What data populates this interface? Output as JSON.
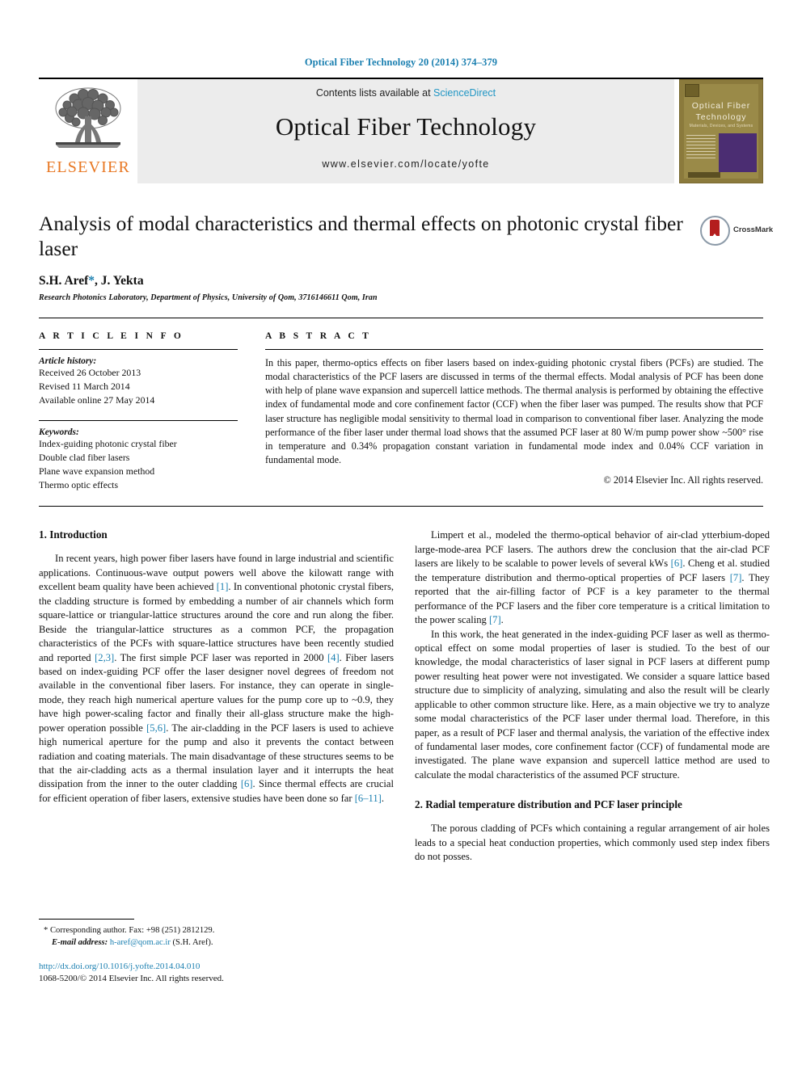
{
  "running_head": "Optical Fiber Technology 20 (2014) 374–379",
  "masthead": {
    "publisher_name": "ELSEVIER",
    "contents_prefix": "Contents lists available at ",
    "sciencedirect": "ScienceDirect",
    "journal_title": "Optical Fiber Technology",
    "journal_url": "www.elsevier.com/locate/yofte",
    "cover": {
      "line1": "Optical  Fiber",
      "line2": "Technology",
      "line3": "Materials, Devices, and Systems"
    }
  },
  "article": {
    "title": "Analysis of modal characteristics and thermal effects on photonic crystal fiber laser",
    "authors": "S.H. Aref",
    "author_star": "*",
    "authors_rest": ", J. Yekta",
    "affiliation": "Research Photonics Laboratory, Department of Physics, University of Qom, 3716146611 Qom, Iran",
    "crossmark_label": "CrossMark"
  },
  "info": {
    "heading": "A R T I C L E   I N F O",
    "history_label": "Article history:",
    "history": [
      "Received 26 October 2013",
      "Revised 11 March 2014",
      "Available online 27 May 2014"
    ],
    "keywords_label": "Keywords:",
    "keywords": [
      "Index-guiding photonic crystal fiber",
      "Double clad fiber lasers",
      "Plane wave expansion method",
      "Thermo optic effects"
    ]
  },
  "abstract": {
    "heading": "A B S T R A C T",
    "text": "In this paper, thermo-optics effects on fiber lasers based on index-guiding photonic crystal fibers (PCFs) are studied. The modal characteristics of the PCF lasers are discussed in terms of the thermal effects. Modal analysis of PCF has been done with help of plane wave expansion and supercell lattice methods. The thermal analysis is performed by obtaining the effective index of fundamental mode and core confinement factor (CCF) when the fiber laser was pumped. The results show that PCF laser structure has negligible modal sensitivity to thermal load in comparison to conventional fiber laser. Analyzing the mode performance of the fiber laser under thermal load shows that the assumed PCF laser at 80 W/m pump power show ~500° rise in temperature and 0.34% propagation constant variation in fundamental mode index and 0.04% CCF variation in fundamental mode.",
    "copyright": "© 2014 Elsevier Inc. All rights reserved."
  },
  "body": {
    "section1_heading": "1. Introduction",
    "section2_heading": "2. Radial temperature distribution and PCF laser principle",
    "left_p1_a": "In recent years, high power fiber lasers have found in large industrial and scientific applications. Continuous-wave output powers well above the kilowatt range with excellent beam quality have been achieved ",
    "left_p1_r1": "[1]",
    "left_p1_b": ". In conventional photonic crystal fibers, the cladding structure is formed by embedding a number of air channels which form square-lattice or triangular-lattice structures around the core and run along the fiber. Beside the triangular-lattice structures as a common PCF, the propagation characteristics of the PCFs with square-lattice structures have been recently studied and reported ",
    "left_p1_r2": "[2,3]",
    "left_p1_c": ". The first simple PCF laser was reported in 2000 ",
    "left_p1_r3": "[4]",
    "left_p1_d": ". Fiber lasers based on index-guiding PCF offer the laser designer novel degrees of freedom not available in the conventional fiber lasers. For instance, they can operate in single-mode, they reach high numerical aperture values for the pump core up to ~0.9, they have high power-scaling factor and finally their all-glass structure make the high-power operation possible ",
    "left_p1_r4": "[5,6]",
    "left_p1_e": ". The air-cladding in the PCF lasers is used to achieve high numerical aperture for the pump and also it prevents the contact between radiation and coating materials. The main disadvantage of these structures seems to be that the air-cladding acts as a thermal insulation layer and it interrupts the heat dissipation from the inner to the outer cladding ",
    "left_p1_r5": "[6]",
    "left_p1_f": ". Since thermal effects are crucial for efficient operation of fiber lasers, extensive studies have been done so far ",
    "left_p1_r6": "[6–11]",
    "left_p1_g": ".",
    "right_p1_a": "Limpert et al., modeled the thermo-optical behavior of air-clad ytterbium-doped large-mode-area PCF lasers. The authors drew the conclusion that the air-clad PCF lasers are likely to be scalable to power levels of several kWs ",
    "right_p1_r1": "[6]",
    "right_p1_b": ". Cheng et al. studied the temperature distribution and thermo-optical properties of PCF lasers ",
    "right_p1_r2": "[7]",
    "right_p1_c": ". They reported that the air-filling factor of PCF is a key parameter to the thermal performance of the PCF lasers and the fiber core temperature is a critical limitation to the power scaling ",
    "right_p1_r3": "[7]",
    "right_p1_d": ".",
    "right_p2": "In this work, the heat generated in the index-guiding PCF laser as well as thermo-optical effect on some modal properties of laser is studied. To the best of our knowledge, the modal characteristics of laser signal in PCF lasers at different pump power resulting heat power were not investigated. We consider a square lattice based structure due to simplicity of analyzing, simulating and also the result will be clearly applicable to other common structure like. Here, as a main objective we try to analyze some modal characteristics of the PCF laser under thermal load. Therefore, in this paper, as a result of PCF laser and thermal analysis, the variation of the effective index of fundamental laser modes, core confinement factor (CCF) of fundamental mode are investigated. The plane wave expansion and supercell lattice method are used to calculate the modal characteristics of the assumed PCF structure.",
    "right_p3": "The porous cladding of PCFs which containing a regular arrangement of air holes leads to a special heat conduction properties, which commonly used step index fibers do not posses."
  },
  "footnotes": {
    "corresponding_marker": "*",
    "corresponding": "Corresponding author. Fax: +98 (251) 2812129.",
    "email_label": "E-mail address:",
    "email": "h-aref@qom.ac.ir",
    "email_suffix": "(S.H. Aref).",
    "doi": "http://dx.doi.org/10.1016/j.yofte.2014.04.010",
    "issn": "1068-5200/© 2014 Elsevier Inc. All rights reserved."
  },
  "colors": {
    "link_blue": "#1a7fb0",
    "elsevier_orange": "#E87722",
    "band_gray": "#ececec",
    "crossmark_red": "#b41e1e"
  }
}
